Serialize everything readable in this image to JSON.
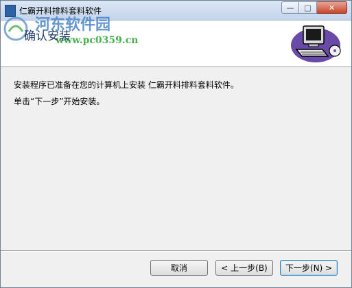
{
  "window": {
    "title": "仁霸开料排料套料软件",
    "caption_buttons": [
      "minimize-icon",
      "maximize-icon",
      "close-icon"
    ]
  },
  "banner": {
    "heading": "确认安装",
    "watermark_name": "河东软件园",
    "watermark_url": "www.pc0359.cn"
  },
  "content": {
    "line1": "安装程序已准备在您的计算机上安装 仁霸开料排料套料软件。",
    "line2": "单击“下一步”开始安装。"
  },
  "buttons": {
    "cancel": "取消",
    "back": "< 上一步(B)",
    "next": "下一步(N) >"
  },
  "colors": {
    "accent": "#3c7fb1",
    "banner_title": "#1f3a66",
    "watermark_blue": "#4a86c8",
    "watermark_green": "#4bb14f"
  }
}
